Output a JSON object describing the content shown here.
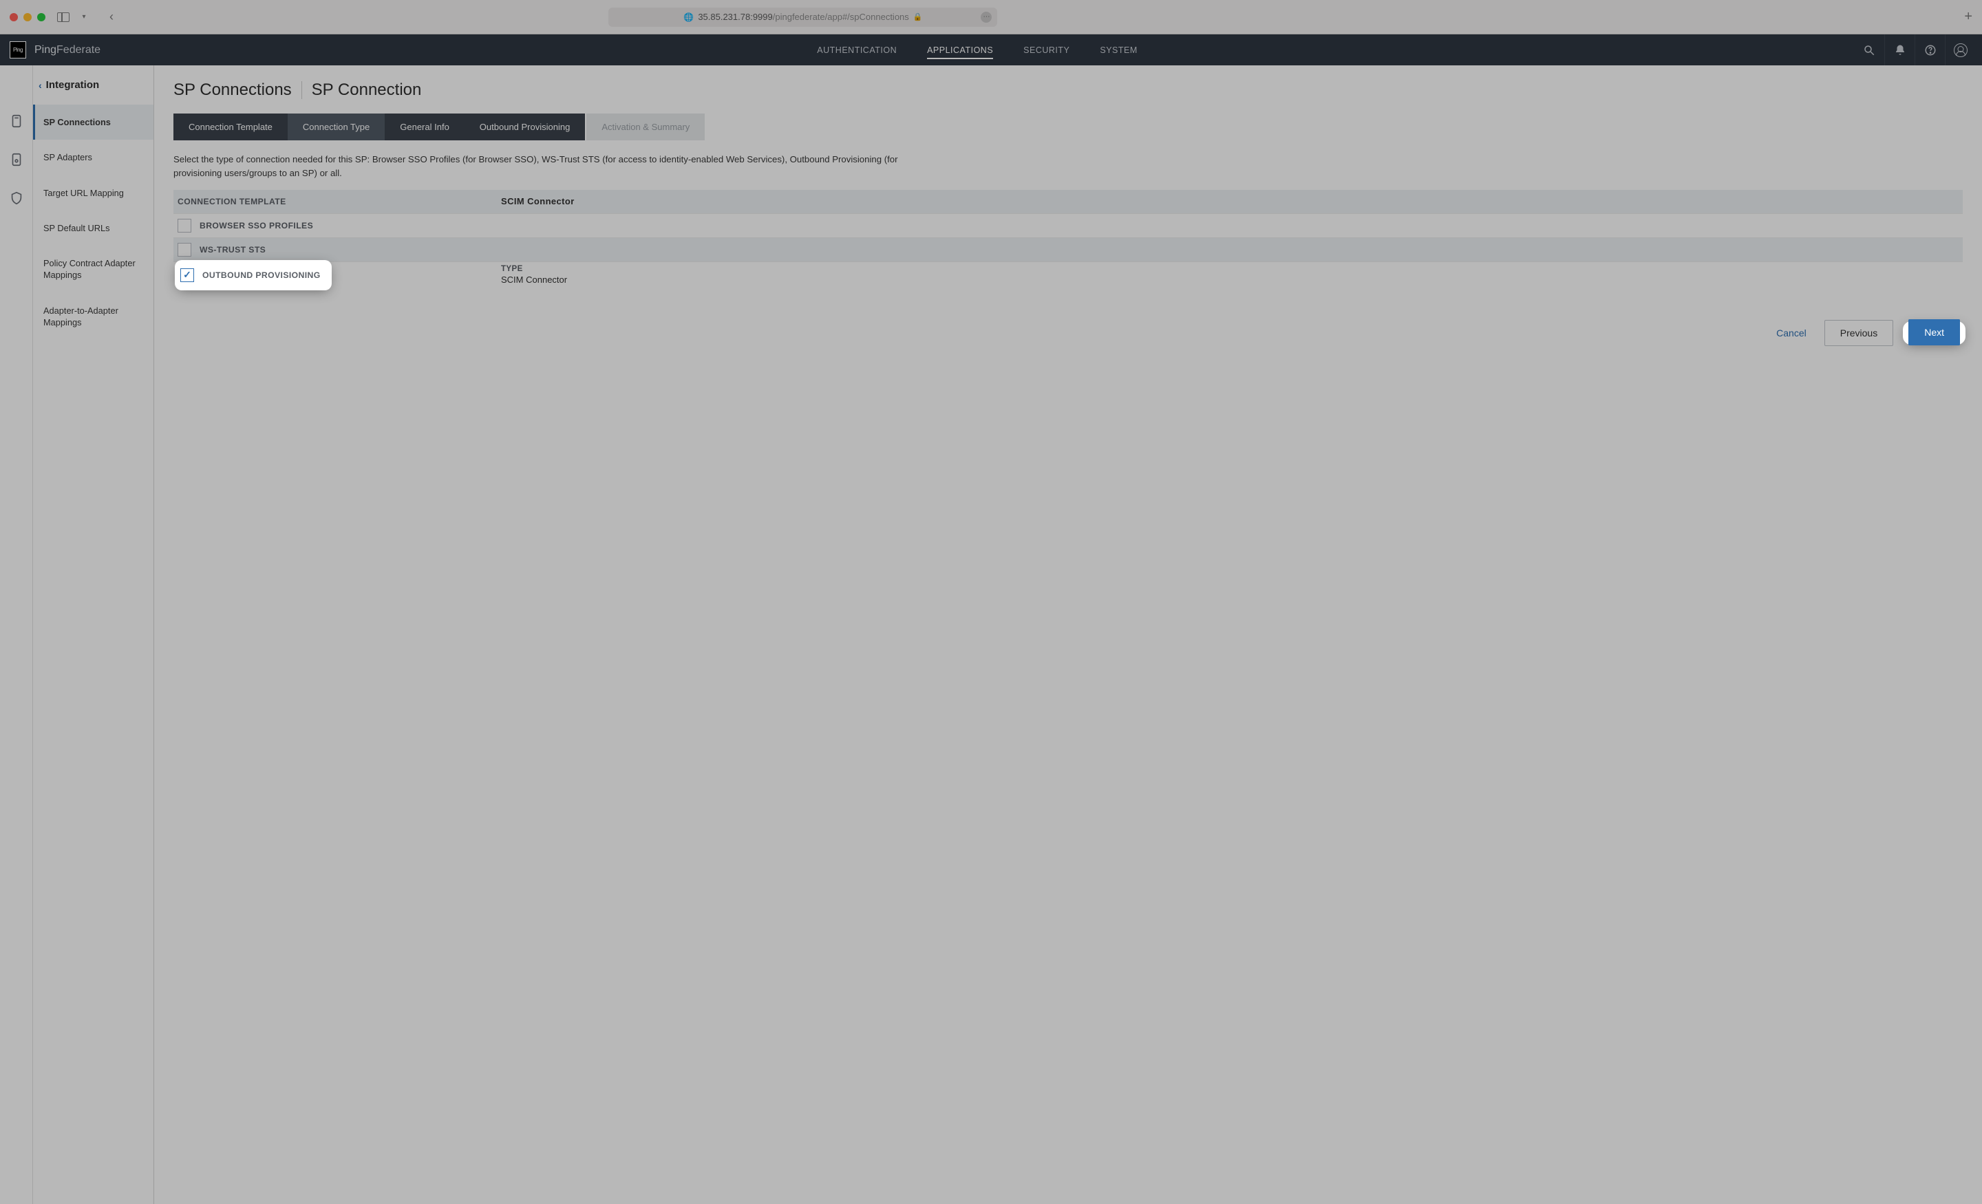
{
  "browser": {
    "url_host": "35.85.231.78:9999",
    "url_path": "/pingfederate/app#/spConnections"
  },
  "brand": {
    "logo_text": "Ping",
    "name_strong": "Ping",
    "name_light": "Federate"
  },
  "top_tabs": {
    "items": [
      "AUTHENTICATION",
      "APPLICATIONS",
      "SECURITY",
      "SYSTEM"
    ],
    "active_index": 1
  },
  "sidebar": {
    "heading": "Integration",
    "items": [
      {
        "label": "SP Connections"
      },
      {
        "label": "SP Adapters"
      },
      {
        "label": "Target URL Mapping"
      },
      {
        "label": "SP Default URLs"
      },
      {
        "label": "Policy Contract Adapter Mappings"
      },
      {
        "label": "Adapter-to-Adapter Mappings"
      }
    ],
    "active_index": 0
  },
  "breadcrumb": {
    "parent": "SP Connections",
    "current": "SP Connection"
  },
  "step_tabs": {
    "items": [
      "Connection Template",
      "Connection Type",
      "General Info",
      "Outbound Provisioning",
      "Activation & Summary"
    ],
    "active_index": 1,
    "disabled_indices": [
      4
    ]
  },
  "description": "Select the type of connection needed for this SP: Browser SSO Profiles (for Browser SSO), WS-Trust STS (for access to identity-enabled Web Services), Outbound Provisioning (for provisioning users/groups to an SP) or all.",
  "form": {
    "template_label": "CONNECTION TEMPLATE",
    "template_value": "SCIM Connector",
    "options": [
      {
        "label": "BROWSER SSO PROFILES",
        "checked": false
      },
      {
        "label": "WS-TRUST STS",
        "checked": false
      },
      {
        "label": "OUTBOUND PROVISIONING",
        "checked": true,
        "type_label": "TYPE",
        "type_value": "SCIM Connector"
      }
    ]
  },
  "buttons": {
    "cancel": "Cancel",
    "previous": "Previous",
    "next": "Next"
  }
}
